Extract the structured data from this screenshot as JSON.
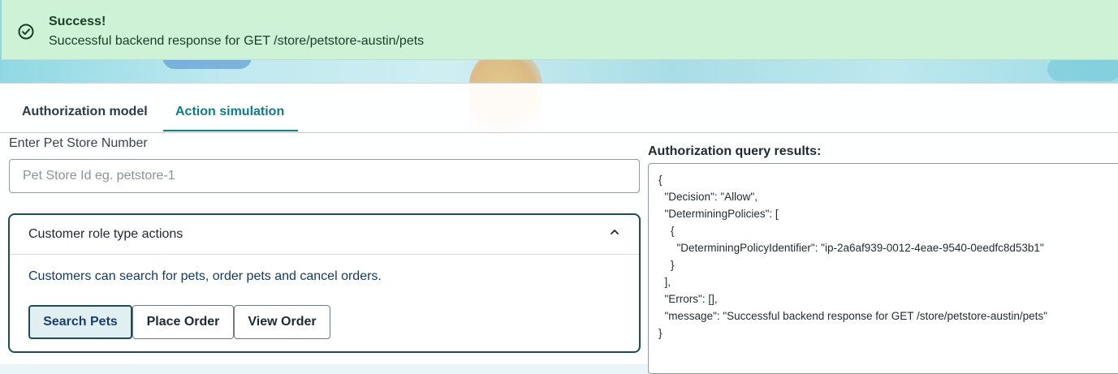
{
  "notification": {
    "title": "Success!",
    "message": "Successful backend response for GET /store/petstore-austin/pets",
    "icon": "check-circle-icon",
    "background_color": "#cdf2d6"
  },
  "tabs": [
    {
      "label": "Authorization model",
      "active": false
    },
    {
      "label": "Action simulation",
      "active": true
    }
  ],
  "accent_color": "#0a7f8a",
  "store_field": {
    "label": "Enter Pet Store Number",
    "value": "",
    "placeholder": "Pet Store Id eg. petstore-1"
  },
  "accordion": {
    "title": "Customer role type actions",
    "expanded": true,
    "chevron_icon": "chevron-up-icon",
    "description": "Customers can search for pets, order pets and cancel orders.",
    "buttons": [
      {
        "label": "Search Pets",
        "active": true
      },
      {
        "label": "Place Order",
        "active": false
      },
      {
        "label": "View Order",
        "active": false
      }
    ]
  },
  "results": {
    "label": "Authorization query results:",
    "json_text": "{\n  \"Decision\": \"Allow\",\n  \"DeterminingPolicies\": [\n    {\n      \"DeterminingPolicyIdentifier\": \"ip-2a6af939-0012-4eae-9540-0eedfc8d53b1\"\n    }\n  ],\n  \"Errors\": [],\n  \"message\": \"Successful backend response for GET /store/petstore-austin/pets\"\n}"
  }
}
